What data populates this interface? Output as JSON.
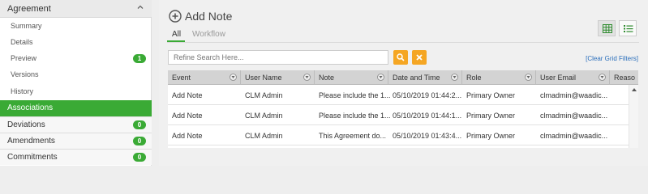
{
  "sidebar": {
    "section_title": "Agreement",
    "sub_items": [
      {
        "label": "Summary",
        "badge": ""
      },
      {
        "label": "Details",
        "badge": ""
      },
      {
        "label": "Preview",
        "badge": "1"
      },
      {
        "label": "Versions",
        "badge": ""
      },
      {
        "label": "History",
        "badge": ""
      }
    ],
    "active_item": {
      "label": "Associations"
    },
    "items": [
      {
        "label": "Deviations",
        "badge": "0"
      },
      {
        "label": "Amendments",
        "badge": "0"
      },
      {
        "label": "Commitments",
        "badge": "0"
      }
    ]
  },
  "main": {
    "title": "Add Note",
    "tabs": [
      {
        "label": "All",
        "active": true
      },
      {
        "label": "Workflow",
        "active": false
      }
    ],
    "search": {
      "placeholder": "Refine Search Here..."
    },
    "clear_filters": "[Clear Grid Filters]"
  },
  "grid": {
    "columns": [
      "Event",
      "User Name",
      "Note",
      "Date and Time",
      "Role",
      "User Email",
      "Reaso"
    ],
    "rows": [
      [
        "Add Note",
        "CLM Admin",
        "Please include the 1...",
        "05/10/2019 01:44:2...",
        "Primary Owner",
        "clmadmin@waadic..."
      ],
      [
        "Add Note",
        "CLM Admin",
        "Please include the 1...",
        "05/10/2019 01:44:1...",
        "Primary Owner",
        "clmadmin@waadic..."
      ],
      [
        "Add Note",
        "CLM Admin",
        "This Agreement do...",
        "05/10/2019 01:43:4...",
        "Primary Owner",
        "clmadmin@waadic..."
      ]
    ]
  },
  "colors": {
    "accent_green": "#3aaa35",
    "search_orange": "#f5a623",
    "link_blue": "#2a6ebb"
  },
  "icons": [
    "chevron-up-icon",
    "plus-circle-icon",
    "grid-view-icon",
    "list-view-icon",
    "search-icon",
    "clear-icon",
    "filter-icon",
    "scroll-up-icon"
  ]
}
